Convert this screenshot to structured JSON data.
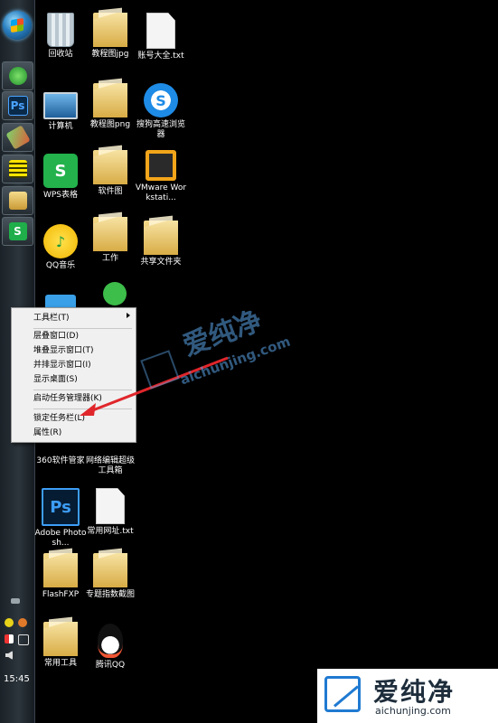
{
  "desktop": {
    "icons": [
      {
        "label": "回收站"
      },
      {
        "label": "教程图jpg"
      },
      {
        "label": "账号大全.txt"
      },
      {
        "label": "计算机"
      },
      {
        "label": "教程图png"
      },
      {
        "label": "搜狗高速浏览器"
      },
      {
        "label": "WPS表格"
      },
      {
        "label": "软件图"
      },
      {
        "label": "VMware Workstati..."
      },
      {
        "label": "QQ音乐"
      },
      {
        "label": "工作"
      },
      {
        "label": "共享文件夹"
      },
      {
        "label": "360软件管家"
      },
      {
        "label": "网络编辑超级工具箱"
      },
      {
        "label": "Adobe Photosh..."
      },
      {
        "label": "常用网址.txt"
      },
      {
        "label": "FlashFXP"
      },
      {
        "label": "专题指数截图"
      },
      {
        "label": "常用工具"
      },
      {
        "label": "腾讯QQ"
      }
    ]
  },
  "context_menu": {
    "items": [
      {
        "label": "工具栏(T)"
      },
      {
        "label": "层叠窗口(D)"
      },
      {
        "label": "堆叠显示窗口(T)"
      },
      {
        "label": "并排显示窗口(I)"
      },
      {
        "label": "显示桌面(S)"
      },
      {
        "label": "启动任务管理器(K)"
      },
      {
        "label": "锁定任务栏(L)"
      },
      {
        "label": "属性(R)"
      }
    ]
  },
  "taskbar": {
    "clock": "15:45",
    "buttons": [
      {
        "label": ""
      },
      {
        "label": "Ps"
      },
      {
        "label": ""
      },
      {
        "label": ""
      },
      {
        "label": ""
      },
      {
        "label": "S"
      }
    ]
  },
  "watermark": {
    "cn": "爱纯净",
    "url": "aichunjing.com",
    "accent": "#1f7ad1"
  },
  "colors": {
    "arrow": "#e0262b",
    "menu_bg": "#f0f0f0"
  }
}
